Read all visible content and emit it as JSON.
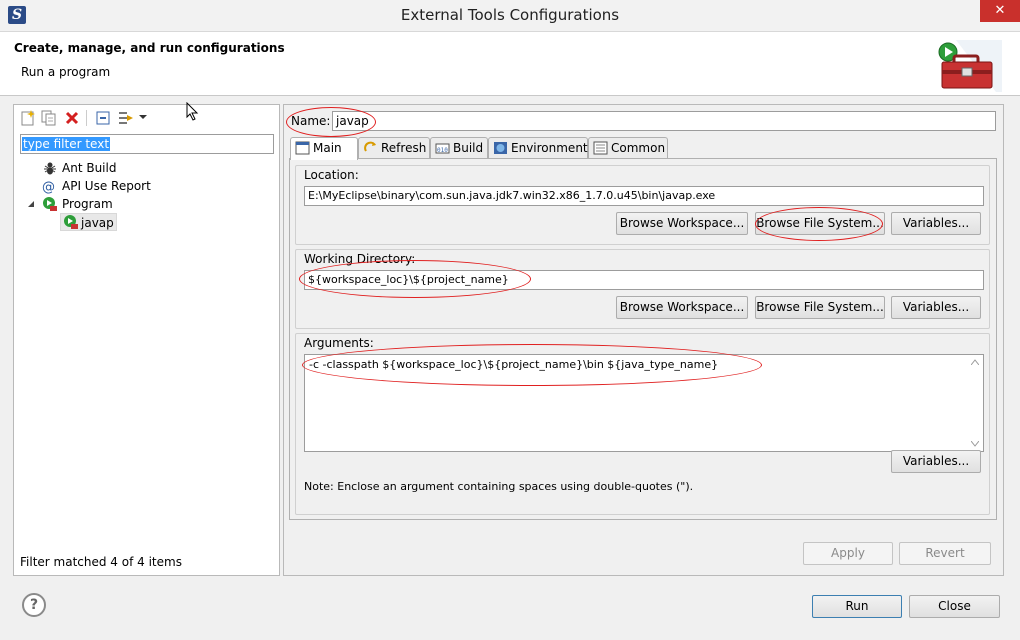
{
  "window": {
    "title": "External Tools Configurations",
    "app_icon": "eclipse-icon",
    "close_label": "✕"
  },
  "header": {
    "title": "Create, manage, and run configurations",
    "subtitle": "Run a program",
    "icon": "toolbox-run-icon"
  },
  "left_panel": {
    "toolbar_icons": [
      "new-config-icon",
      "duplicate-icon",
      "delete-icon",
      "collapse-all-icon",
      "filter-icon",
      "dropdown-arrow-icon"
    ],
    "filter_placeholder": "type filter text",
    "tree": [
      {
        "label": "Ant Build",
        "icon": "ant-icon"
      },
      {
        "label": "API Use Report",
        "icon": "api-report-icon"
      },
      {
        "label": "Program",
        "icon": "program-icon"
      },
      {
        "label": "javap",
        "icon": "program-config-icon"
      }
    ],
    "status": "Filter matched 4 of 4 items"
  },
  "config": {
    "name_label": "Name:",
    "name_value": "javap",
    "tabs": [
      "Main",
      "Refresh",
      "Build",
      "Environment",
      "Common"
    ],
    "active_tab": "Main",
    "location": {
      "label": "Location:",
      "value": "E:\\MyEclipse\\binary\\com.sun.java.jdk7.win32.x86_1.7.0.u45\\bin\\javap.exe",
      "buttons": [
        "Browse Workspace...",
        "Browse File System...",
        "Variables..."
      ]
    },
    "working_dir": {
      "label": "Working Directory:",
      "value": "${workspace_loc}\\${project_name}",
      "buttons": [
        "Browse Workspace...",
        "Browse File System...",
        "Variables..."
      ]
    },
    "arguments": {
      "label": "Arguments:",
      "value": "-c  -classpath ${workspace_loc}\\${project_name}\\bin  ${java_type_name}",
      "variables_button": "Variables...",
      "note": "Note: Enclose an argument containing spaces using double-quotes (\")."
    },
    "apply_label": "Apply",
    "revert_label": "Revert"
  },
  "footer": {
    "help_label": "?",
    "run_label": "Run",
    "close_label": "Close"
  },
  "colors": {
    "annotation": "#e02020",
    "selection": "#3399ff"
  }
}
